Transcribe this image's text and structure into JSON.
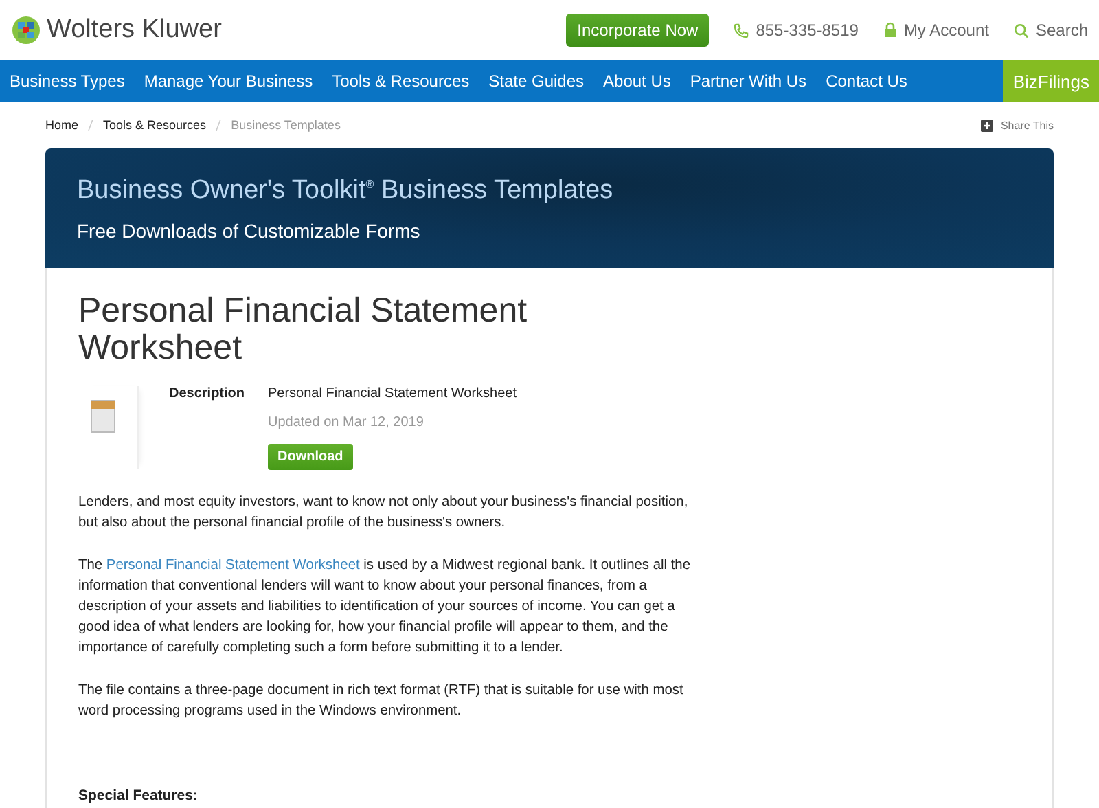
{
  "header": {
    "brand": "Wolters Kluwer",
    "cta": "Incorporate Now",
    "phone": "855-335-8519",
    "account": "My Account",
    "search": "Search"
  },
  "nav": {
    "items": [
      "Business Types",
      "Manage Your Business",
      "Tools & Resources",
      "State Guides",
      "About Us",
      "Partner With Us",
      "Contact Us"
    ],
    "brand": "BizFilings"
  },
  "breadcrumb": {
    "items": [
      {
        "label": "Home",
        "current": false
      },
      {
        "label": "Tools & Resources",
        "current": false
      },
      {
        "label": "Business Templates",
        "current": true
      }
    ],
    "share": "Share This"
  },
  "hero": {
    "title": "Business Owner's Toolkit",
    "mark": "®",
    "title_rest": "Business Templates",
    "subtitle": "Free Downloads of Customizable Forms"
  },
  "document": {
    "title": "Personal Financial Statement Worksheet",
    "description_label": "Description",
    "description": "Personal Financial Statement Worksheet",
    "updated": "Updated on Mar 12, 2019",
    "download": "Download"
  },
  "paragraphs": [
    {
      "kind": "text",
      "text": "Lenders, and most equity investors, want to know not only about your business's financial position, but also about the personal financial profile of the business's owners."
    },
    {
      "kind": "link",
      "before": "The",
      "link": "Personal Financial Statement Worksheet",
      "after": "is used by a Midwest regional bank. It outlines all the information that conventional lenders will want to know about your personal finances, from a description of your assets and liabilities to identification of your sources of income. You can get a good idea of what lenders are looking for, how your financial profile will appear to them, and the importance of carefully completing such a form before submitting it to a lender."
    },
    {
      "kind": "text",
      "text": "The file contains a three-page document in rich text format (RTF) that is suitable for use with most word processing programs used in the Windows environment."
    }
  ],
  "special_heading": "Special Features:"
}
